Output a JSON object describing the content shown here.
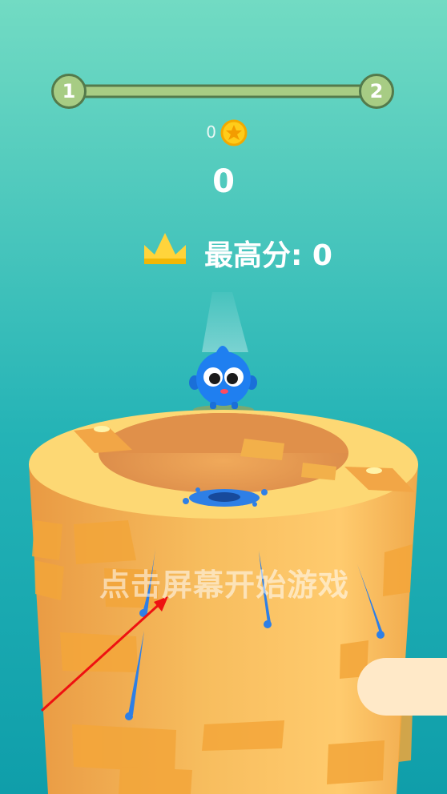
{
  "level_progress": {
    "current_level": "1",
    "next_level": "2",
    "progress": 0
  },
  "coins": {
    "count": "0",
    "icon": "star-coin-icon"
  },
  "score": {
    "value": "0"
  },
  "best_score": {
    "label": "最高分: 0",
    "icon": "crown-icon"
  },
  "hint": {
    "text": "点击屏幕开始游戏"
  },
  "controls": {
    "toggle_icon": "half-circle-toggle-icon"
  },
  "colors": {
    "background_top": "#72dbc3",
    "background_bottom": "#0f9eaa",
    "tower": "#f7bd5e",
    "tower_top": "#fdd874",
    "character": "#1f7ff0",
    "splash": "#2e7fe6",
    "arrow": "#ee1111"
  }
}
